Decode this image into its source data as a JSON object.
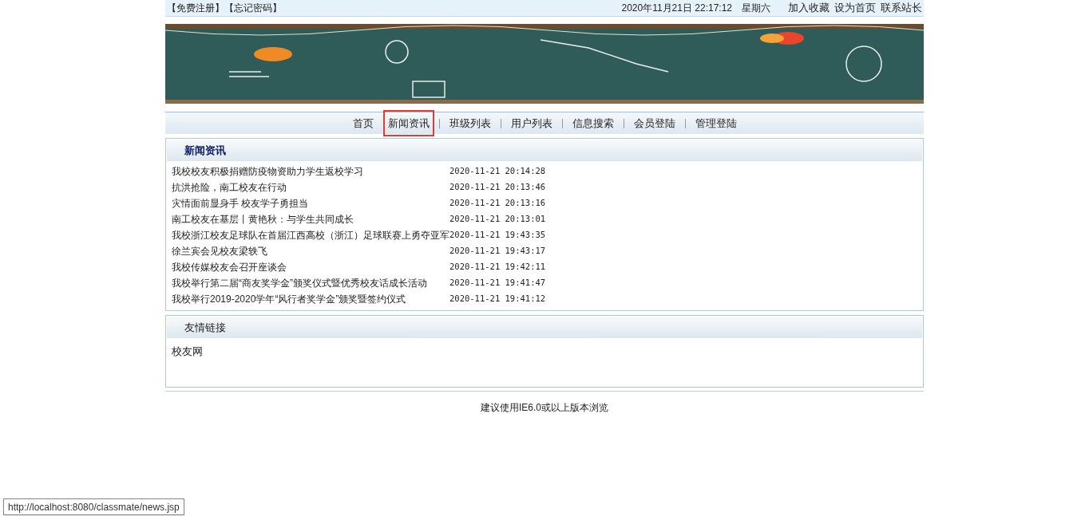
{
  "top_bar": {
    "links_left": [
      "【免费注册】",
      "【忘记密码】"
    ],
    "datetime": "2020年11月21日  22:17:12",
    "weekday": "星期六",
    "links_right": [
      "加入收藏",
      "设为首页",
      "联系站长"
    ]
  },
  "nav": [
    {
      "label": "首页",
      "selected": false
    },
    {
      "label": "新闻资讯",
      "selected": true
    },
    {
      "label": "班级列表",
      "selected": false
    },
    {
      "label": "用户列表",
      "selected": false
    },
    {
      "label": "信息搜索",
      "selected": false
    },
    {
      "label": "会员登陆",
      "selected": false
    },
    {
      "label": "管理登陆",
      "selected": false
    }
  ],
  "news": {
    "title": "新闻资讯",
    "items": [
      {
        "title": "我校校友积极捐赠防疫物资助力学生返校学习",
        "time": "2020-11-21 20:14:28"
      },
      {
        "title": "抗洪抢险，南工校友在行动",
        "time": "2020-11-21 20:13:46"
      },
      {
        "title": "灾情面前显身手 校友学子勇担当",
        "time": "2020-11-21 20:13:16"
      },
      {
        "title": "南工校友在基层丨黄艳秋：与学生共同成长",
        "time": "2020-11-21 20:13:01"
      },
      {
        "title": "我校浙江校友足球队在首届江西高校（浙江）足球联赛上勇夺亚军",
        "time": "2020-11-21 19:43:35"
      },
      {
        "title": "徐兰宾会见校友梁轶飞",
        "time": "2020-11-21 19:43:17"
      },
      {
        "title": "我校传媒校友会召开座谈会",
        "time": "2020-11-21 19:42:11"
      },
      {
        "title": "我校举行第二届“商友奖学金”颁奖仪式暨优秀校友话成长活动",
        "time": "2020-11-21 19:41:47"
      },
      {
        "title": "我校举行2019-2020学年“风行者奖学金”颁奖暨签约仪式",
        "time": "2020-11-21 19:41:12"
      }
    ]
  },
  "friend_links": {
    "title": "友情链接",
    "items": [
      "校友网"
    ]
  },
  "footer": "建议使用IE6.0或以上版本浏览",
  "status_bar": "http://localhost:8080/classmate/news.jsp"
}
